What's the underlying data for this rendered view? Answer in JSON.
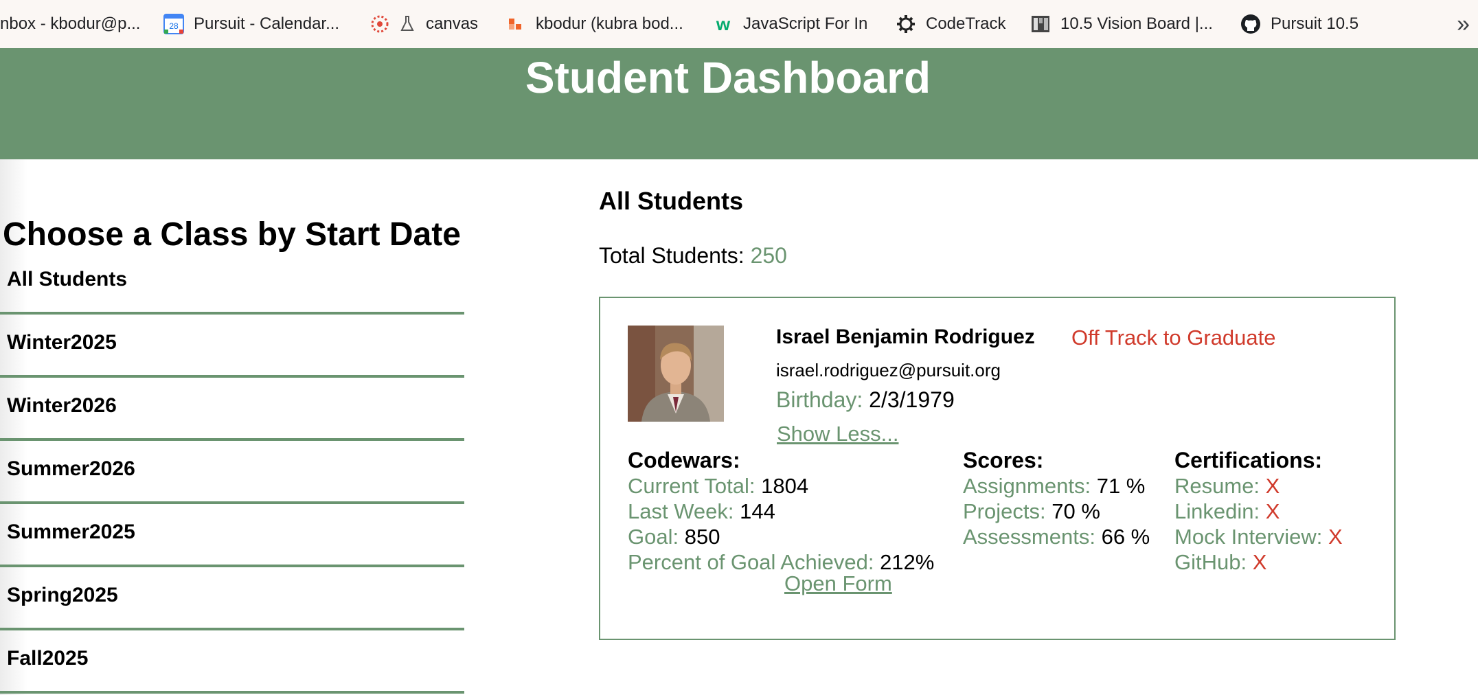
{
  "bookmarks": [
    {
      "label": "nbox - kbodur@p...",
      "icon": "gmail-icon"
    },
    {
      "label": "Pursuit - Calendar...",
      "icon": "calendar-icon",
      "icon_text": "28"
    },
    {
      "label": "canvas",
      "icon": "canvas-icon"
    },
    {
      "label": "kbodur (kubra bod...",
      "icon": "hash-icon"
    },
    {
      "label": "JavaScript For In",
      "icon": "w3schools-icon"
    },
    {
      "label": "CodeTrack",
      "icon": "gear-icon"
    },
    {
      "label": "10.5 Vision Board |...",
      "icon": "vision-board-icon"
    },
    {
      "label": "Pursuit 10.5",
      "icon": "github-icon"
    }
  ],
  "bookmarks_more": "»",
  "header": {
    "title": "Student Dashboard"
  },
  "sidebar": {
    "heading": "Choose a Class by Start Date",
    "classes": [
      {
        "label": "All Students"
      },
      {
        "label": "Winter2025"
      },
      {
        "label": "Winter2026"
      },
      {
        "label": "Summer2026"
      },
      {
        "label": "Summer2025"
      },
      {
        "label": "Spring2025"
      },
      {
        "label": "Fall2025"
      }
    ]
  },
  "main": {
    "heading": "All Students",
    "total_label": "Total Students:",
    "total_value": "250"
  },
  "student": {
    "name": "Israel Benjamin Rodriguez",
    "status": "Off Track to Graduate",
    "email": "israel.rodriguez@pursuit.org",
    "birthday_label": "Birthday:",
    "birthday_value": "2/3/1979",
    "show_less": "Show Less...",
    "codewars": {
      "heading": "Codewars:",
      "current_total_label": "Current Total:",
      "current_total_value": "1804",
      "last_week_label": "Last Week:",
      "last_week_value": "144",
      "goal_label": "Goal:",
      "goal_value": "850",
      "percent_label": "Percent of Goal Achieved:",
      "percent_value": "212%"
    },
    "scores": {
      "heading": "Scores:",
      "assignments_label": "Assignments:",
      "assignments_value": "71 %",
      "projects_label": "Projects:",
      "projects_value": "70 %",
      "assessments_label": "Assessments:",
      "assessments_value": "66 %"
    },
    "certifications": {
      "heading": "Certifications:",
      "resume_label": "Resume:",
      "resume_value": "X",
      "linkedin_label": "Linkedin:",
      "linkedin_value": "X",
      "mock_interview_label": "Mock Interview:",
      "mock_interview_value": "X",
      "github_label": "GitHub:",
      "github_value": "X"
    },
    "open_form": "Open Form"
  },
  "colors": {
    "accent": "#6a9470",
    "warning": "#d03a2b",
    "header_text": "#ffffff"
  }
}
